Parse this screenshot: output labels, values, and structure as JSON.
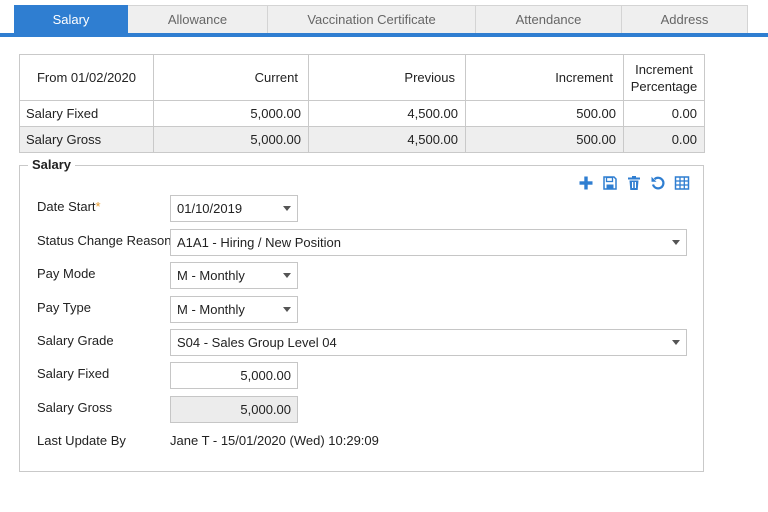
{
  "tabs": [
    {
      "label": "Salary",
      "active": true
    },
    {
      "label": "Allowance",
      "active": false
    },
    {
      "label": "Vaccination Certificate",
      "active": false
    },
    {
      "label": "Attendance",
      "active": false
    },
    {
      "label": "Address",
      "active": false
    }
  ],
  "summary": {
    "headers": {
      "from": "From 01/02/2020",
      "current": "Current",
      "previous": "Previous",
      "increment": "Increment",
      "pct_line1": "Increment",
      "pct_line2": "Percentage"
    },
    "rows": [
      {
        "label": "Salary Fixed",
        "current": "5,000.00",
        "previous": "4,500.00",
        "increment": "500.00",
        "pct": "0.00"
      },
      {
        "label": "Salary Gross",
        "current": "5,000.00",
        "previous": "4,500.00",
        "increment": "500.00",
        "pct": "0.00"
      }
    ]
  },
  "section": {
    "title": "Salary",
    "toolbar_icons": [
      "plus-icon",
      "save-icon",
      "trash-icon",
      "undo-icon",
      "grid-icon"
    ]
  },
  "form": {
    "date_start_label": "Date Start",
    "required_mark": "*",
    "date_start_value": "01/10/2019",
    "status_reason_label": "Status Change Reason",
    "status_reason_value": "A1A1 - Hiring / New Position",
    "pay_mode_label": "Pay Mode",
    "pay_mode_value": "M - Monthly",
    "pay_type_label": "Pay Type",
    "pay_type_value": "M - Monthly",
    "salary_grade_label": "Salary Grade",
    "salary_grade_value": "S04 - Sales Group Level 04",
    "salary_fixed_label": "Salary Fixed",
    "salary_fixed_value": "5,000.00",
    "salary_gross_label": "Salary Gross",
    "salary_gross_value": "5,000.00",
    "last_update_label": "Last Update By",
    "last_update_value": "Jane T - 15/01/2020 (Wed) 10:29:09"
  },
  "colors": {
    "accent": "#2f7ed1",
    "required": "#e89a2b"
  }
}
